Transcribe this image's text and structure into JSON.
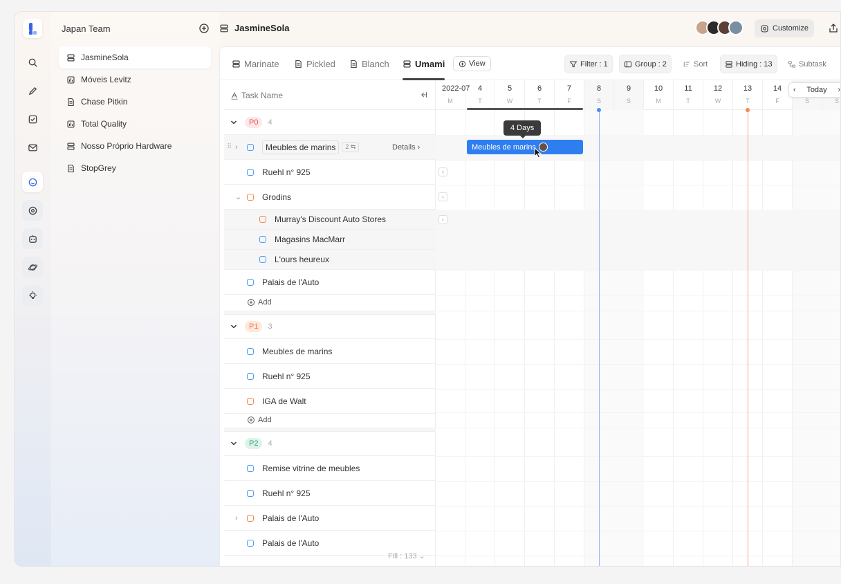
{
  "team": {
    "name": "Japan Team"
  },
  "sidebar": {
    "items": [
      {
        "label": "JasmineSola",
        "icon": "stack-icon",
        "active": true
      },
      {
        "label": "Móveis Levitz",
        "icon": "chart-icon"
      },
      {
        "label": "Chase Pitkin",
        "icon": "doc-icon"
      },
      {
        "label": "Total Quality",
        "icon": "chart-icon"
      },
      {
        "label": "Nosso Próprio Hardware",
        "icon": "stack-icon"
      },
      {
        "label": "StopGrey",
        "icon": "doc-icon"
      }
    ]
  },
  "header": {
    "title": "JasmineSola",
    "customize_label": "Customize"
  },
  "tabs": [
    {
      "label": "Marinate"
    },
    {
      "label": "Pickled"
    },
    {
      "label": "Blanch"
    },
    {
      "label": "Umami",
      "active": true
    }
  ],
  "toolbar": {
    "view_label": "View",
    "filter_label": "Filter : 1",
    "group_label": "Group : 2",
    "sort_label": "Sort",
    "hiding_label": "Hiding : 13",
    "subtask_label": "Subtask"
  },
  "table": {
    "column_header": "Task Name",
    "details_label": "Details",
    "subtask_count": "2",
    "add_label": "Add",
    "fill_label": "Fill : 133",
    "groups": [
      {
        "badge": "P0",
        "count": "4"
      },
      {
        "badge": "P1",
        "count": "3"
      },
      {
        "badge": "P2",
        "count": "4"
      }
    ],
    "rows": {
      "p0": [
        "Meubles de marins",
        "Ruehl n° 925",
        "Grodins",
        "Murray's Discount Auto Stores",
        "Magasins MacMarr",
        "L'ours heureux",
        "Palais de l'Auto"
      ],
      "p1": [
        "Meubles de marins",
        "Ruehl n° 925",
        "IGA de Walt"
      ],
      "p2": [
        "Remise vitrine de meubles",
        "Ruehl n° 925",
        "Palais de l'Auto",
        "Palais de l'Auto"
      ]
    }
  },
  "gantt": {
    "month": "2022-07",
    "days": [
      {
        "n": "",
        "w": "M"
      },
      {
        "n": "4",
        "w": "T"
      },
      {
        "n": "5",
        "w": "W"
      },
      {
        "n": "6",
        "w": "T"
      },
      {
        "n": "7",
        "w": "F"
      },
      {
        "n": "8",
        "w": "S"
      },
      {
        "n": "9",
        "w": "S"
      },
      {
        "n": "10",
        "w": "M"
      },
      {
        "n": "11",
        "w": "T"
      },
      {
        "n": "12",
        "w": "W"
      },
      {
        "n": "13",
        "w": "T"
      },
      {
        "n": "14",
        "w": "F"
      },
      {
        "n": "",
        "w": "S"
      },
      {
        "n": "",
        "w": "S"
      }
    ],
    "today_label": "Today",
    "tooltip": "4 Days",
    "bar_label": "Meubles de marins"
  },
  "colors": {
    "accent": "#2f7ef0",
    "today_marker": "#8cb8f5",
    "milestone_marker": "#f5a36f"
  }
}
